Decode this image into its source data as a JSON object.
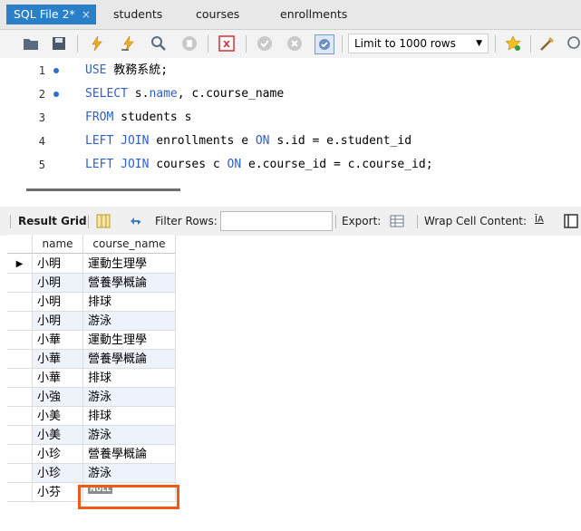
{
  "tabs": [
    {
      "label": "SQL File 2*",
      "active": true,
      "close": "×"
    },
    {
      "label": "students"
    },
    {
      "label": "courses"
    },
    {
      "label": "enrollments"
    }
  ],
  "toolbar": {
    "limit_label": "Limit to 1000 rows",
    "icons": [
      "folder-icon",
      "save-icon",
      "execute-icon",
      "execute-current-icon",
      "explain-icon",
      "stop-icon",
      "toggle-error-icon",
      "commit-icon",
      "rollback-icon",
      "autocommit-icon",
      "favorite-icon",
      "beautify-icon",
      "find-icon"
    ]
  },
  "editor": {
    "lines": [
      {
        "number": "1",
        "marker": true,
        "tokens": [
          {
            "t": "USE",
            "kw": true
          },
          {
            "t": " 教務系統;"
          }
        ]
      },
      {
        "number": "2",
        "marker": true,
        "tokens": [
          {
            "t": "SELECT",
            "kw": true
          },
          {
            "t": " s."
          },
          {
            "t": "name",
            "kw": true
          },
          {
            "t": ", c.course_name"
          }
        ]
      },
      {
        "number": "3",
        "marker": false,
        "tokens": [
          {
            "t": "FROM",
            "kw": true
          },
          {
            "t": " students s"
          }
        ]
      },
      {
        "number": "4",
        "marker": false,
        "tokens": [
          {
            "t": "LEFT JOIN",
            "kw": true
          },
          {
            "t": " enrollments e "
          },
          {
            "t": "ON",
            "kw": true
          },
          {
            "t": " s.id = e.student_id"
          }
        ]
      },
      {
        "number": "5",
        "marker": false,
        "tokens": [
          {
            "t": "LEFT JOIN",
            "kw": true
          },
          {
            "t": " courses c "
          },
          {
            "t": "ON",
            "kw": true
          },
          {
            "t": " e.course_id = c.course_id;"
          }
        ]
      }
    ]
  },
  "result_bar": {
    "result_grid": "Result Grid",
    "filter_rows": "Filter Rows:",
    "filter_value": "",
    "export": "Export:",
    "wrap": "Wrap Cell Content:",
    "wrap_icon_text": "ĪA"
  },
  "grid": {
    "columns": [
      "name",
      "course_name"
    ],
    "current_row_marker": "▶",
    "rows": [
      {
        "name": "小明",
        "course_name": "運動生理學"
      },
      {
        "name": "小明",
        "course_name": "營養學概論"
      },
      {
        "name": "小明",
        "course_name": "排球"
      },
      {
        "name": "小明",
        "course_name": "游泳"
      },
      {
        "name": "小華",
        "course_name": "運動生理學"
      },
      {
        "name": "小華",
        "course_name": "營養學概論"
      },
      {
        "name": "小華",
        "course_name": "排球"
      },
      {
        "name": "小強",
        "course_name": "游泳"
      },
      {
        "name": "小美",
        "course_name": "排球"
      },
      {
        "name": "小美",
        "course_name": "游泳"
      },
      {
        "name": "小珍",
        "course_name": "營養學概論"
      },
      {
        "name": "小珍",
        "course_name": "游泳"
      },
      {
        "name": "小芬",
        "course_name": null,
        "null_label": "NULL"
      }
    ]
  },
  "colors": {
    "accent": "#2a7fc9",
    "keyword": "#2f5fc8",
    "highlight": "#f05a14",
    "alt_row": "#eef3fb"
  }
}
